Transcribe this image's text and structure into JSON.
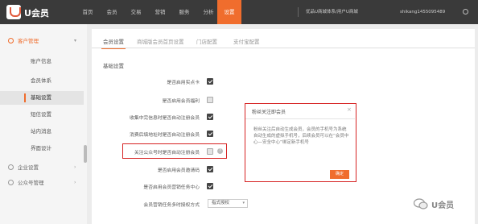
{
  "app": {
    "logo_text": "U会员"
  },
  "nav": {
    "items": [
      "首页",
      "会员",
      "交易",
      "营销",
      "服务",
      "分析",
      "设置"
    ],
    "shop": "优品U商城体系/用户U商城",
    "user": "shikang1455095489"
  },
  "sidebar": {
    "group_member": "客户管理",
    "items": [
      "账户信息",
      "会员体系",
      "基础设置",
      "短信设置",
      "站内消息",
      "界面设计"
    ],
    "group_enterprise": "企业设置",
    "group_public": "公众号管理"
  },
  "tabs": [
    "会员设置",
    "商城版会员首页设置",
    "门店配置",
    "支付宝配置"
  ],
  "section": "基础设置",
  "settings": [
    {
      "label": "是否启用实点卡",
      "checked": true
    },
    {
      "label": "是否启用会员福利",
      "checked": false
    },
    {
      "label": "收集中完信息时是否自动注册会员",
      "checked": true
    },
    {
      "label": "消费后填地址时是否自动注册会员",
      "checked": true
    },
    {
      "label": "关注公众号时是否自动注册会员",
      "checked": false
    },
    {
      "label": "是否启用会员邀请码",
      "checked": true
    },
    {
      "label": "是否启用会员营销任务中心",
      "checked": true
    },
    {
      "label": "会员营销任务多时授权方式"
    }
  ],
  "select_value": "指式授权",
  "dialog": {
    "title": "粉丝关注即会员",
    "close": "×",
    "body": "粉丝关注后自动生成会员，会员的手机号为系统自动生成的虚拟手机号，后续会员可以在“会员中心—安全中心”绑定新手机号",
    "button": "确定"
  },
  "watermark": {
    "text": "U会员"
  },
  "colors": {
    "accent": "#f06d2d",
    "highlight": "#d62222",
    "topbar": "#3a3a3a"
  }
}
